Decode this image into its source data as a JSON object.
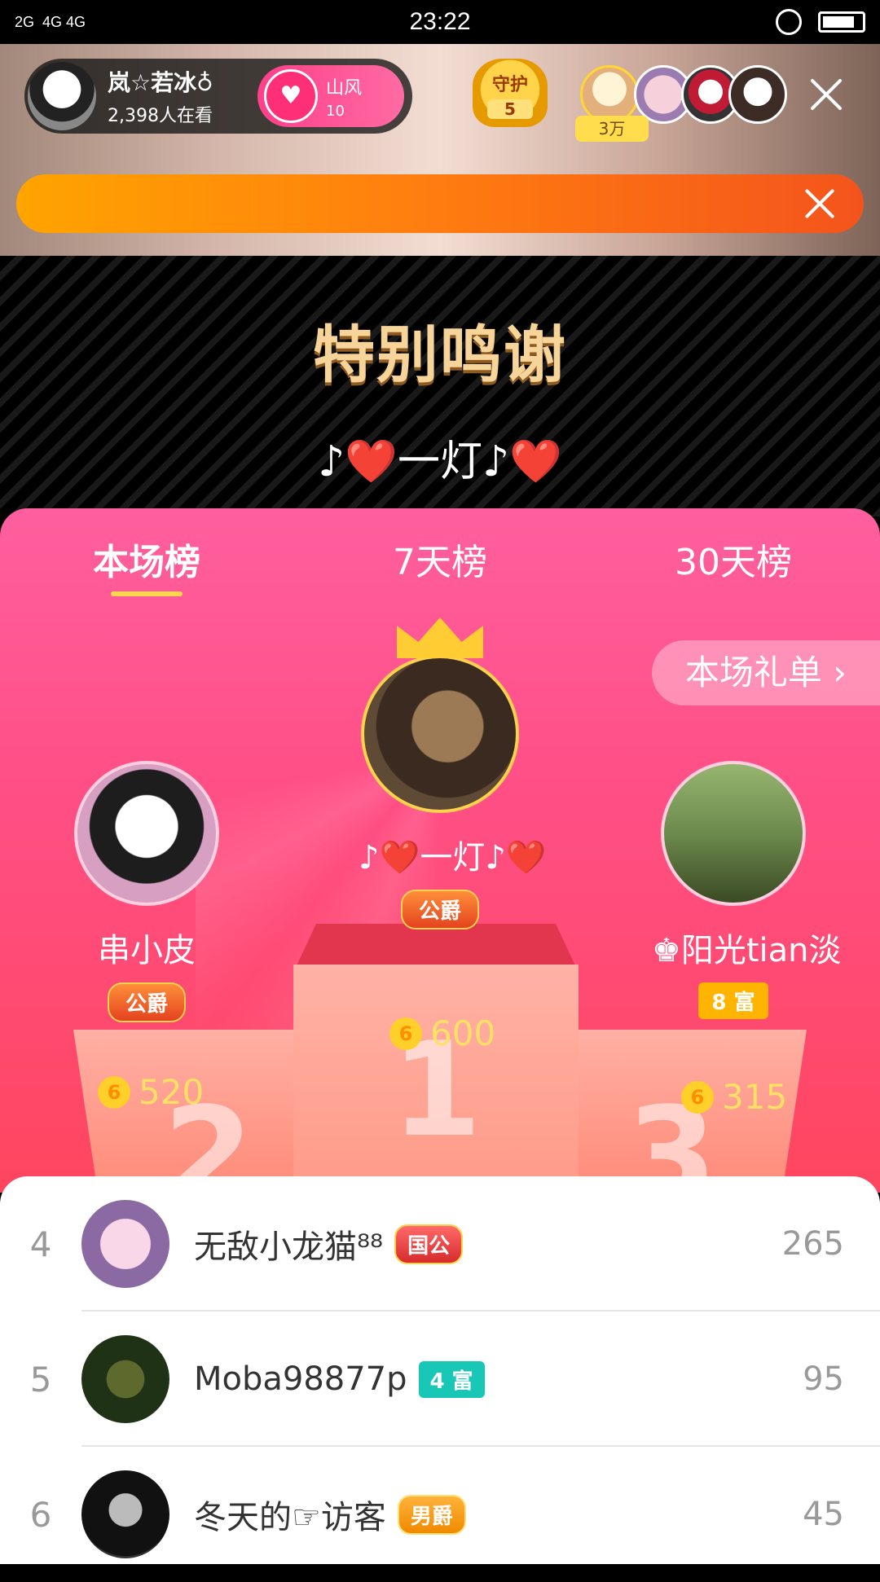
{
  "status_bar": {
    "network_left": "2G",
    "network_right": "4G 4G",
    "time": "23:22"
  },
  "host": {
    "name": "岚☆若冰♁",
    "viewers": "2,398人在看",
    "fan_club": {
      "name": "山风",
      "level": "10"
    }
  },
  "guard": {
    "label": "守护",
    "count": "5"
  },
  "audience": {
    "coins": "3万"
  },
  "thanks": {
    "title": "特别鸣谢",
    "name": "♪❤️一灯♪❤️"
  },
  "tabs": [
    {
      "label": "本场榜"
    },
    {
      "label": "7天榜"
    },
    {
      "label": "30天榜"
    }
  ],
  "gift_list_button": "本场礼单 ›",
  "podium": {
    "first": {
      "name": "♪❤️一灯♪❤️",
      "badge": "公爵",
      "score": "600",
      "rank": "1"
    },
    "second": {
      "name": "串小皮",
      "badge": "公爵",
      "score": "520",
      "rank": "2"
    },
    "third": {
      "name": "♚阳光tian淡",
      "badge": "8 富",
      "score": "315",
      "rank": "3"
    }
  },
  "coin_symbol": "6",
  "leaderboard": [
    {
      "rank": "4",
      "name": "无敌小龙猫⁸⁸",
      "badge": "国公",
      "score": "265"
    },
    {
      "rank": "5",
      "name": "Moba98877p",
      "badge": "4 富",
      "score": "95"
    },
    {
      "rank": "6",
      "name": "冬天的☞访客",
      "badge": "男爵",
      "score": "45"
    }
  ]
}
